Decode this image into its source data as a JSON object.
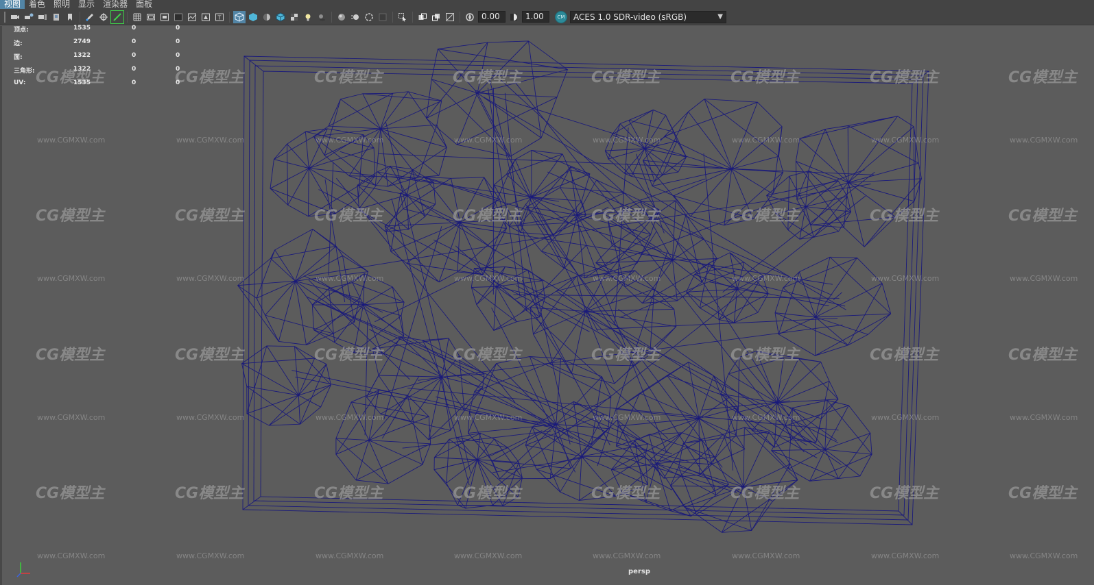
{
  "menu": [
    {
      "label": "视图",
      "active": true
    },
    {
      "label": "着色",
      "active": false
    },
    {
      "label": "照明",
      "active": false
    },
    {
      "label": "显示",
      "active": false
    },
    {
      "label": "渲染器",
      "active": false
    },
    {
      "label": "面板",
      "active": false
    }
  ],
  "toolbar": {
    "exposure_value": "0.00",
    "gamma_value": "1.00",
    "color_badge_text": "CM",
    "color_space": "ACES 1.0 SDR-video (sRGB)"
  },
  "hud": {
    "rows": [
      {
        "label": "顶点:",
        "v1": "1535",
        "v2": "0",
        "v3": "0"
      },
      {
        "label": "边:",
        "v1": "2749",
        "v2": "0",
        "v3": "0"
      },
      {
        "label": "面:",
        "v1": "1322",
        "v2": "0",
        "v3": "0"
      },
      {
        "label": "三角形:",
        "v1": "1322",
        "v2": "0",
        "v3": "0"
      },
      {
        "label": "UV:",
        "v1": "1535",
        "v2": "0",
        "v3": "0"
      }
    ]
  },
  "viewport": {
    "camera": "persp",
    "wire_color": "#1a1a7a",
    "background": "#5c5c5c"
  },
  "watermark": {
    "logo_text": "CG模型主",
    "url_text": "www.CGMXW.com"
  },
  "colors": {
    "accent": "#5285a6",
    "toolbar_bg": "#444444",
    "highlight_green": "#3fd14a"
  }
}
